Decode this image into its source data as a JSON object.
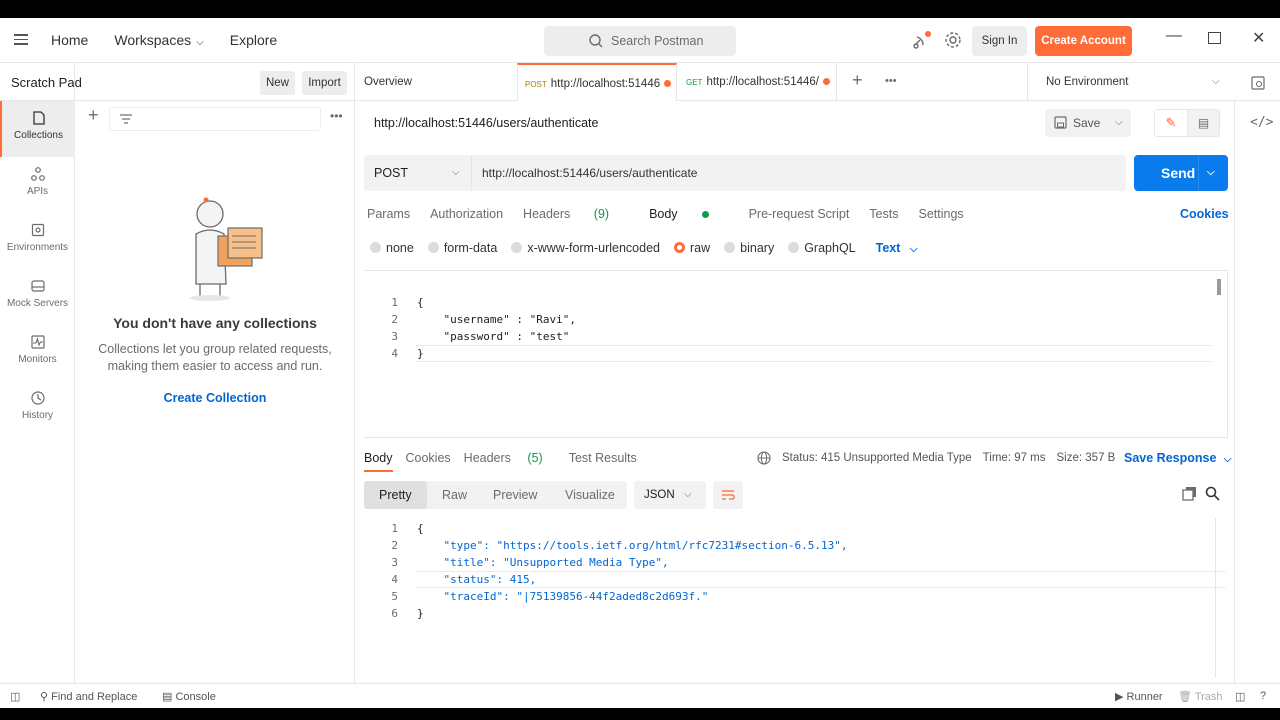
{
  "topbar": {
    "nav": [
      "Home",
      "Workspaces",
      "Explore"
    ],
    "search_placeholder": "Search Postman",
    "signin": "Sign In",
    "create_account": "Create Account"
  },
  "scratch": {
    "title": "Scratch Pad",
    "new": "New",
    "import": "Import"
  },
  "rail": [
    {
      "label": "Collections",
      "icon": "collections-icon"
    },
    {
      "label": "APIs",
      "icon": "apis-icon"
    },
    {
      "label": "Environments",
      "icon": "environments-icon"
    },
    {
      "label": "Mock Servers",
      "icon": "mock-servers-icon"
    },
    {
      "label": "Monitors",
      "icon": "monitors-icon"
    },
    {
      "label": "History",
      "icon": "history-icon"
    }
  ],
  "sidebar": {
    "empty_title": "You don't have any collections",
    "empty_desc": "Collections let you group related requests, making them easier to access and run.",
    "create": "Create Collection"
  },
  "tabs": {
    "overview": "Overview",
    "tab1_method": "POST",
    "tab1_url": "http://localhost:51446",
    "tab2_method": "GET",
    "tab2_url": "http://localhost:51446/",
    "environment": "No Environment"
  },
  "request": {
    "title": "http://localhost:51446/users/authenticate",
    "save": "Save",
    "method": "POST",
    "url": "http://localhost:51446/users/authenticate",
    "send": "Send",
    "tabs": [
      "Params",
      "Authorization",
      "Headers",
      "Body",
      "Pre-request Script",
      "Tests",
      "Settings"
    ],
    "headers_count": "(9)",
    "cookies": "Cookies",
    "body_types": [
      "none",
      "form-data",
      "x-www-form-urlencoded",
      "raw",
      "binary",
      "GraphQL"
    ],
    "format": "Text",
    "body_lines": [
      "{",
      "    \"username\" : \"Ravi\",",
      "    \"password\" : \"test\"",
      "}"
    ]
  },
  "response": {
    "tabs": [
      "Body",
      "Cookies",
      "Headers",
      "Test Results"
    ],
    "headers_count": "(5)",
    "status": "Status: 415 Unsupported Media Type",
    "time": "Time: 97 ms",
    "size": "Size: 357 B",
    "save_response": "Save Response",
    "views": [
      "Pretty",
      "Raw",
      "Preview",
      "Visualize"
    ],
    "format": "JSON",
    "lines": [
      "{",
      "    \"type\": \"https://tools.ietf.org/html/rfc7231#section-6.5.13\",",
      "    \"title\": \"Unsupported Media Type\",",
      "    \"status\": 415,",
      "    \"traceId\": \"|75139856-44f2aded8c2d693f.\"",
      "}"
    ]
  },
  "statusbar": {
    "find": "Find and Replace",
    "console": "Console",
    "runner": "Runner",
    "trash": "Trash"
  },
  "colors": {
    "accent": "#ff6c37",
    "primary": "#097bed",
    "link": "#0265d2",
    "success": "#0f9b4a"
  }
}
